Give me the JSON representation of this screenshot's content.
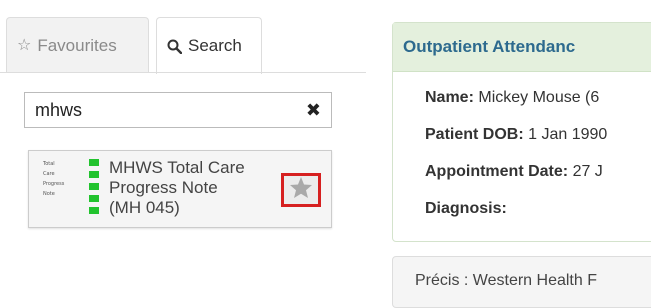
{
  "tabs": {
    "favourites": {
      "label": "Favourites",
      "icon": "star-outline-icon"
    },
    "search": {
      "label": "Search",
      "icon": "magnifier-icon"
    }
  },
  "search": {
    "value": "mhws",
    "clear_icon": "close-icon"
  },
  "result": {
    "title_lines": [
      "MHWS Total Care",
      "Progress Note",
      "(MH 045)"
    ],
    "thumbnail_labels": [
      "Total",
      "Care",
      "Progress",
      "Note"
    ],
    "thumbnail_color": "#22c32e",
    "star_icon": "star-icon",
    "highlight_color": "#d62020"
  },
  "attendance": {
    "header": "Outpatient Attendanc",
    "name_label": "Name:",
    "name_value": "Mickey Mouse (6",
    "dob_label": "Patient DOB:",
    "dob_value": "1 Jan 1990",
    "appt_label": "Appointment Date:",
    "appt_value": "27 J",
    "diagnosis_label": "Diagnosis:",
    "diagnosis_value": ""
  },
  "precis": {
    "text": "Précis : Western Health F"
  },
  "colors": {
    "header_bg": "#e4f0dd",
    "header_text": "#2d6a8e"
  }
}
